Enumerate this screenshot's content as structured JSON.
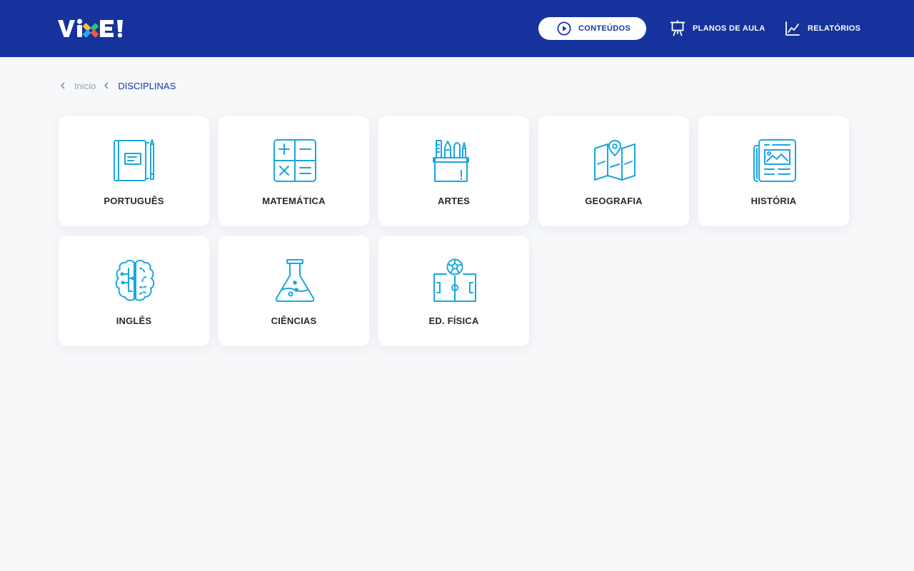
{
  "header": {
    "logo_text": "VIXE!",
    "nav": {
      "conteudos": "CONTEÚDOS",
      "planos": "PLANOS DE AULA",
      "relatorios": "RELATÓRIOS"
    }
  },
  "breadcrumb": {
    "home": "Inicio",
    "current": "DISCIPLINAS"
  },
  "subjects": [
    {
      "label": "PORTUGUÊS",
      "icon": "book-pencil-icon"
    },
    {
      "label": "MATEMÁTICA",
      "icon": "calculator-icon"
    },
    {
      "label": "ARTES",
      "icon": "art-supplies-icon"
    },
    {
      "label": "GEOGRAFIA",
      "icon": "map-pin-icon"
    },
    {
      "label": "HISTÓRIA",
      "icon": "newspaper-icon"
    },
    {
      "label": "INGLÊS",
      "icon": "brain-icon"
    },
    {
      "label": "CIÊNCIAS",
      "icon": "flask-icon"
    },
    {
      "label": "ED. FÍSICA",
      "icon": "soccer-field-icon"
    }
  ],
  "colors": {
    "header_bg": "#16329c",
    "accent": "#1a35a8",
    "icon": "#1aa6e0",
    "page_bg": "#f6f8fa"
  }
}
